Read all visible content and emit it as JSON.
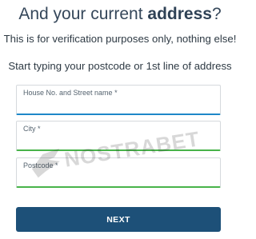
{
  "heading": {
    "prefix": "And your current ",
    "bold": "address",
    "suffix": "?"
  },
  "subtitle": "This is for verification purposes only, nothing else!",
  "instruction": "Start typing your postcode or 1st line of address",
  "fields": {
    "street": {
      "label": "House No. and Street name *",
      "value": ""
    },
    "city": {
      "label": "City *",
      "value": ""
    },
    "postcode": {
      "label": "Postcode *",
      "value": ""
    }
  },
  "next_label": "NEXT",
  "watermark_text": "NOSTRABET",
  "colors": {
    "heading": "#35475a",
    "button": "#1d5078",
    "focus_underline": "#1e88c8",
    "valid_underline": "#48b34a"
  }
}
